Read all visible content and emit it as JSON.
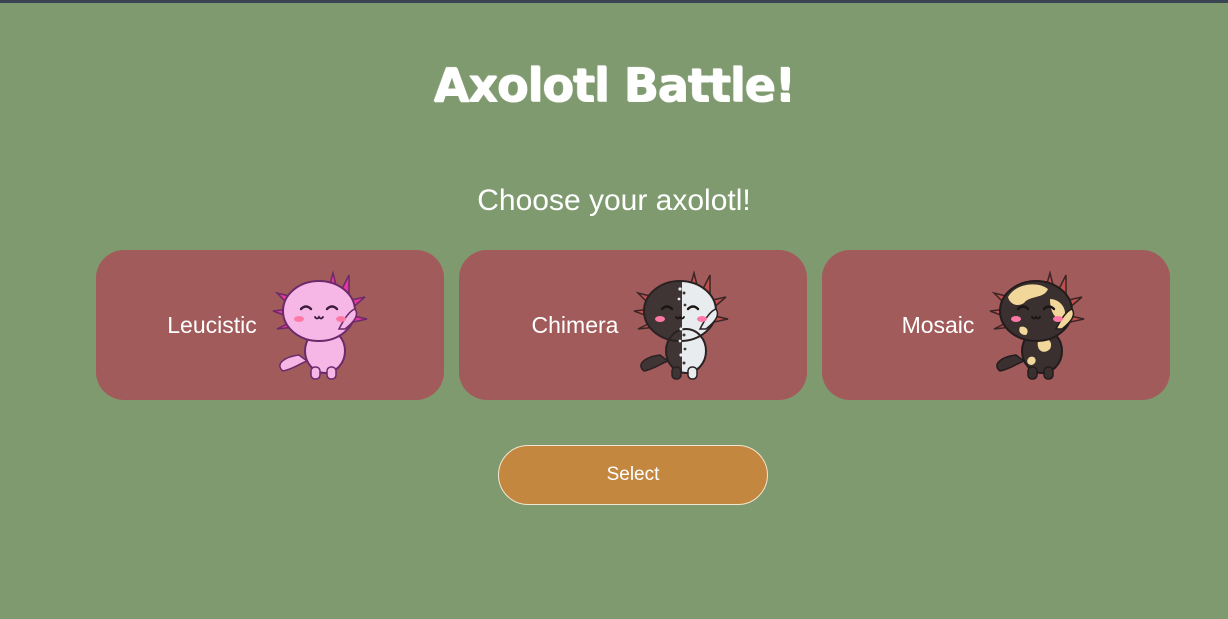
{
  "page": {
    "title": "Axolotl Battle!",
    "subtitle": "Choose your axolotl!"
  },
  "options": [
    {
      "label": "Leucistic",
      "icon": "leucistic-axolotl-icon",
      "colors": {
        "body": "#f6b6e6",
        "outline": "#6b2a6a",
        "gills": "#e6379a",
        "blush": "#ff79a6"
      }
    },
    {
      "label": "Chimera",
      "icon": "chimera-axolotl-icon",
      "colors": {
        "dark": "#3f3535",
        "light": "#e9ecef",
        "gills": "#c24e4e",
        "blush": "#ff79a6"
      }
    },
    {
      "label": "Mosaic",
      "icon": "mosaic-axolotl-icon",
      "colors": {
        "dark": "#3a3030",
        "patch": "#f1d79a",
        "gills": "#c24e4e",
        "blush": "#ff79a6"
      }
    }
  ],
  "actions": {
    "select_label": "Select"
  },
  "theme": {
    "background": "#7f9a6f",
    "card": "#a25b5b",
    "button": "#c4873f",
    "text": "#ffffff",
    "top_bar": "#3a4452"
  }
}
